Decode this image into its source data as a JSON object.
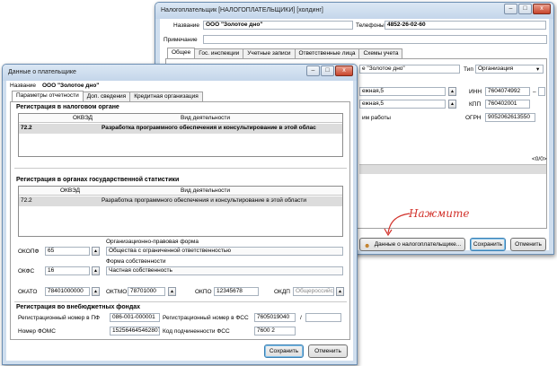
{
  "back_window": {
    "title": "Налогоплательщик [НАЛОГОПЛАТЕЛЬЩИКИ] [холдинг]",
    "controls": [
      "–",
      "□",
      "x"
    ],
    "name_label": "Название",
    "name_value": "ООО \"Золотое дно\"",
    "phones_label": "Телефоны",
    "phones_value": "4852-26-02-60",
    "note_label": "Примечание",
    "note_value": "",
    "tabs": [
      "Общее",
      "Гос. инспекции",
      "Учетные записи",
      "Ответственные лица",
      "Схемы учета"
    ],
    "fragment_name": "е \"Золотое дно\"",
    "type_label": "Тип",
    "type_value": "Организация",
    "address1": "ежная,5",
    "address2": "ежная,5",
    "inn_label": "ИНН",
    "inn_value": "7604074992",
    "inn_extra": "–",
    "kpp_label": "КПП",
    "kpp_value": "760402001",
    "ogrn_label": "ОГРН",
    "ogrn_value": "905206261355​0",
    "work_label": "им работы",
    "pager": "<0/0>",
    "btn_payer": "Данные о налогоплательщике...",
    "btn_save": "Сохранить",
    "btn_cancel": "Отменить"
  },
  "annotation": "Нажмите",
  "front_window": {
    "title": "Данные о плательщике",
    "controls": [
      "–",
      "□",
      "x"
    ],
    "name_label": "Название",
    "name_value": "ООО \"Золотое дно\"",
    "tabs": [
      "Параметры отчетности",
      "Доп. сведения",
      "Кредитная организация"
    ],
    "tax_group": {
      "title": "Регистрация в налоговом органе",
      "col_okved": "ОКВЭД",
      "col_activity": "Вид деятельности",
      "rows": [
        {
          "okved": "72.2",
          "activity": "Разработка программного обеспечения и консультирование в этой облас"
        }
      ]
    },
    "stat_group": {
      "title": "Регистрация в органах государственной статистики",
      "col_okved": "ОКВЭД",
      "col_activity": "Вид деятельности",
      "rows": [
        {
          "okved": "72.2",
          "activity": "Разработка программного обеспечения и консультирование в этой области"
        }
      ],
      "opf_section": "Организационно-правовая форма",
      "okopf_label": "ОКОПФ",
      "okopf_value": "65",
      "okopf_text": "Общества с ограниченной ответственностью",
      "fs_section": "Форма собственности",
      "okfs_label": "ОКФС",
      "okfs_value": "16",
      "okfs_text": "Частная собственность",
      "okato_label": "ОКАТО",
      "okato_value": "78401000000",
      "oktmo_label": "ОКТМО",
      "oktmo_value": "78701000",
      "okpo_label": "ОКПО",
      "okpo_value": "12345678",
      "okdp_label": "ОКДП",
      "okdp_value": "Общероссийский"
    },
    "funds_group": {
      "title": "Регистрация во внебюджетных фондах",
      "pf_label": "Регистрационный номер в ПФ",
      "pf_value": "086-001-000001",
      "fss_label": "Регистрационный номер в ФСС",
      "fss_value": "7605019040",
      "fss_extra": "/",
      "foms_label": "Номер ФОМС",
      "foms_value": "152564645462807",
      "fss_code_label": "Код подчиненности ФСС",
      "fss_code_value": "7600 2"
    },
    "btn_save": "Сохранить",
    "btn_cancel": "Отменить"
  },
  "colors": {
    "annotation": "#d2322b",
    "title_bar": "#c4d6ea",
    "frame_border": "#6d8fb3"
  }
}
